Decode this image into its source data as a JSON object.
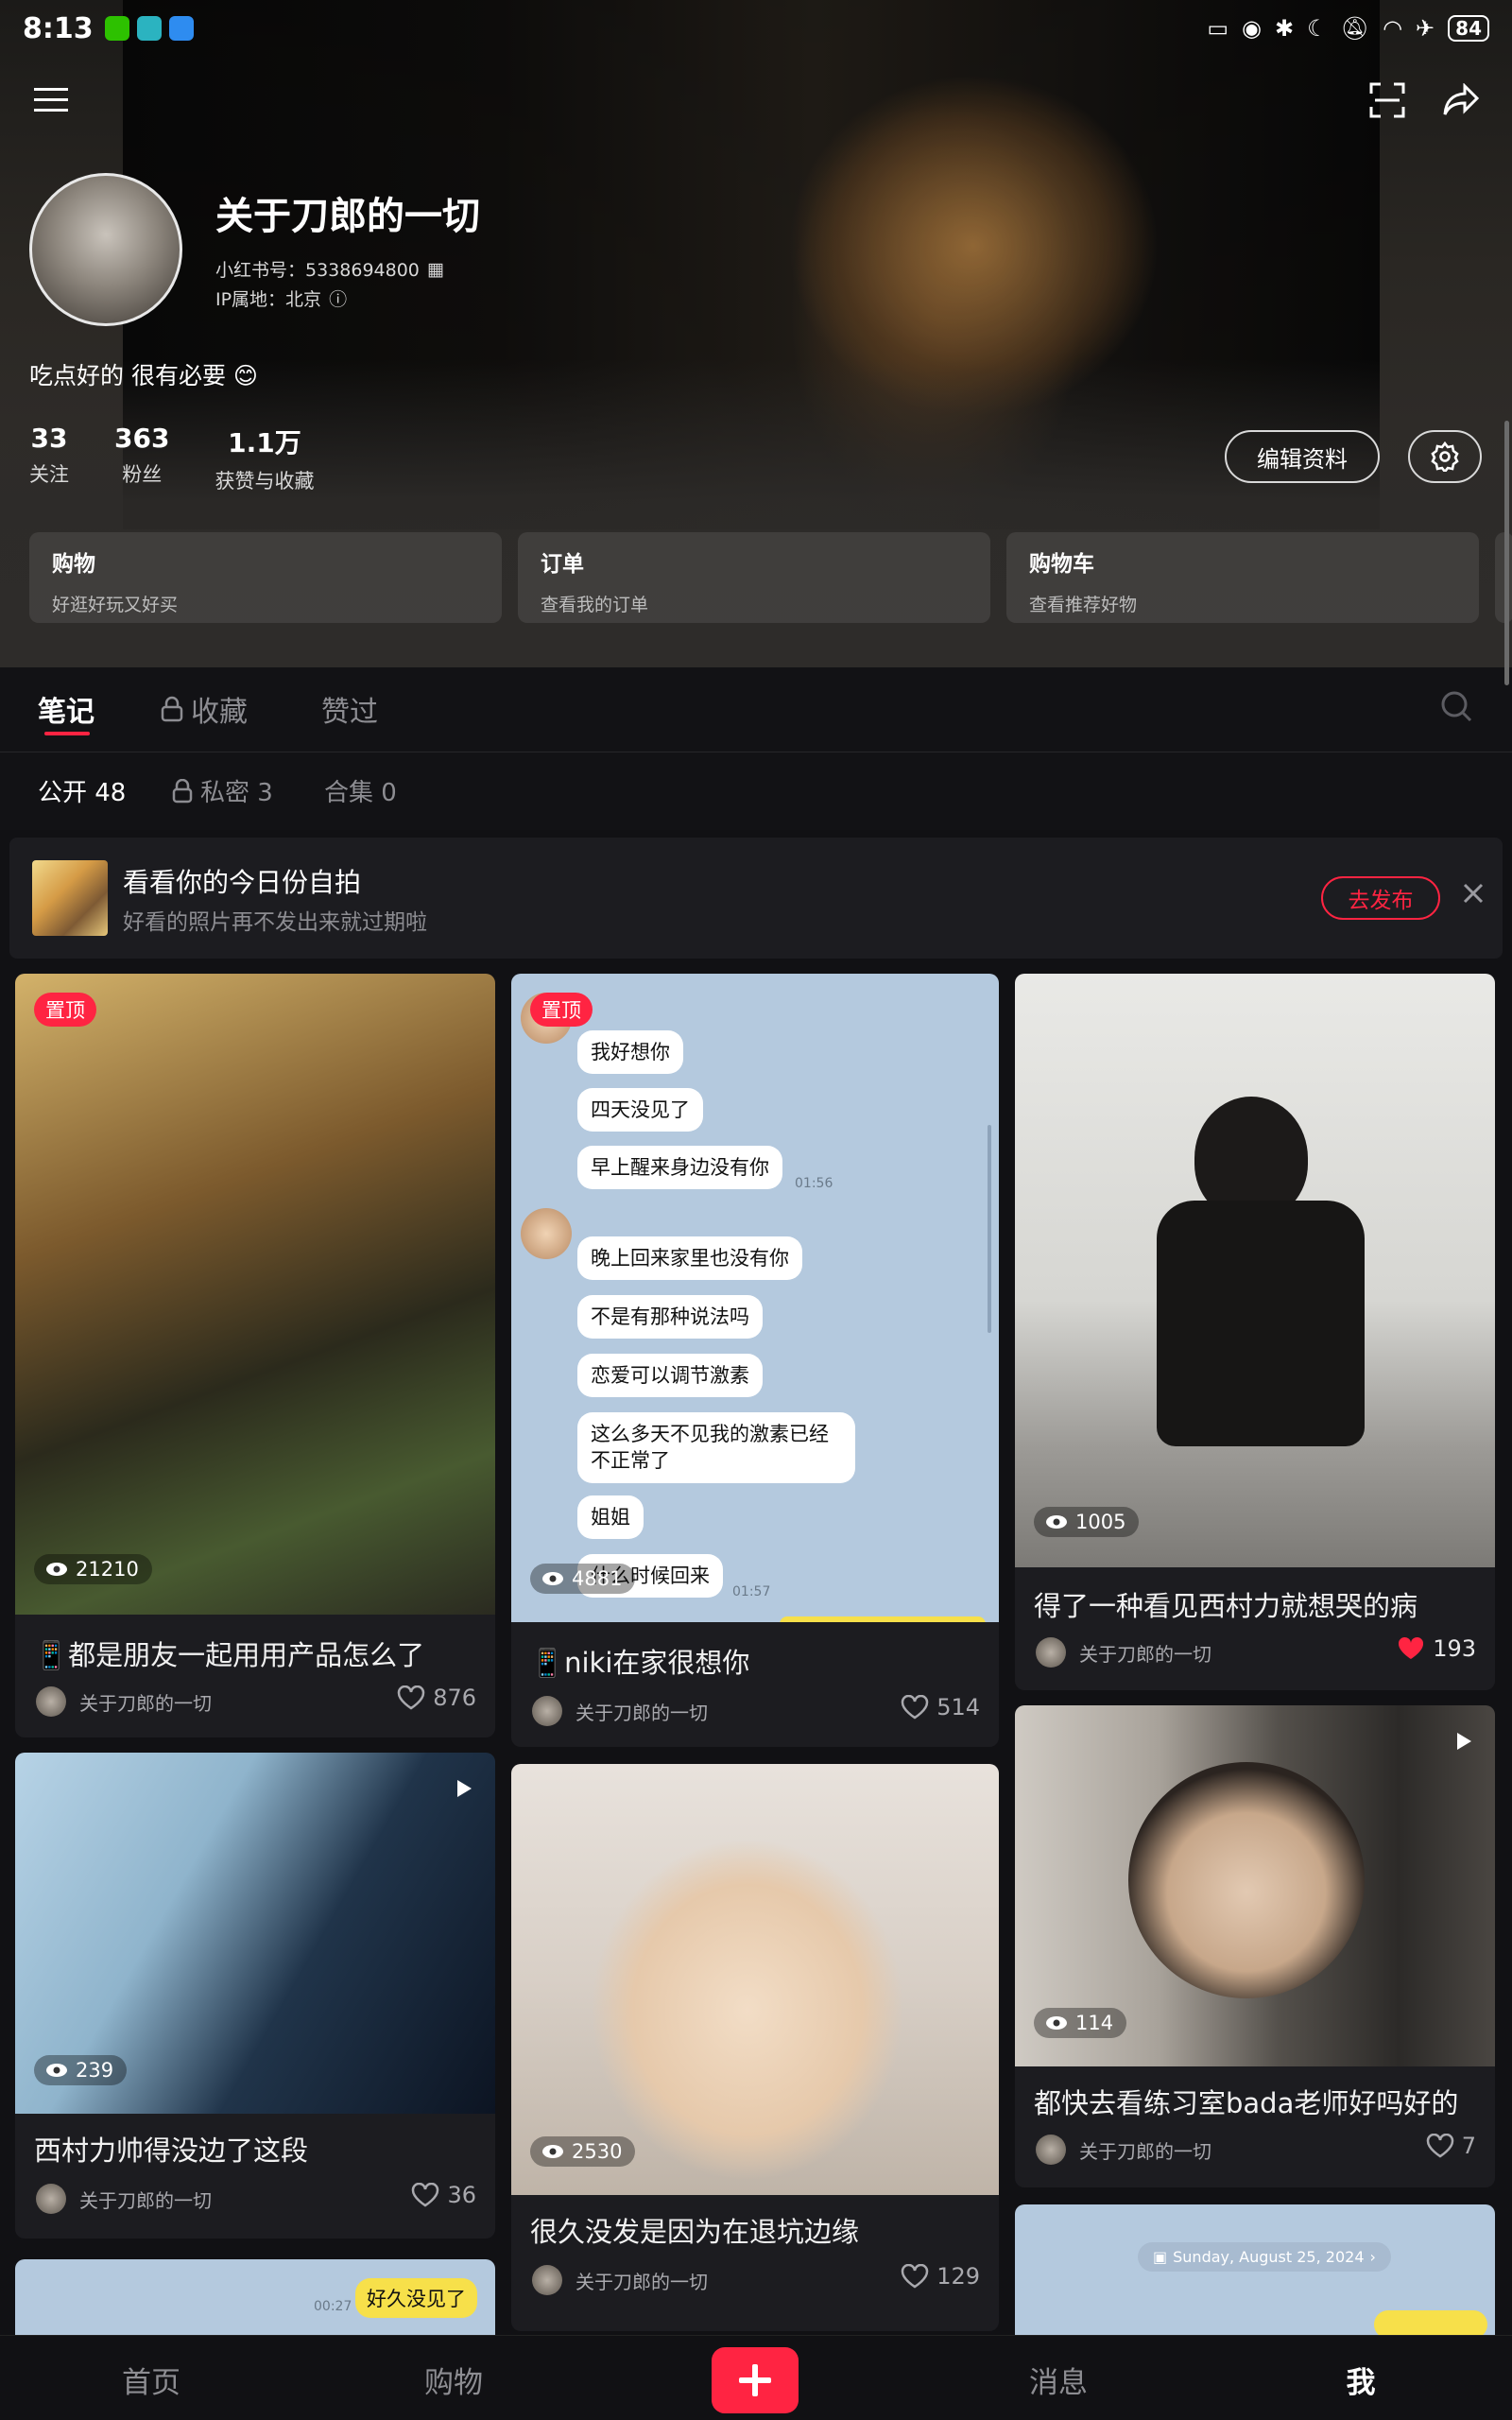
{
  "status_bar": {
    "time": "8:13",
    "battery": "84"
  },
  "profile": {
    "name": "关于刀郎的一切",
    "red_id": "小红书号：5338694800",
    "ip": "IP属地：北京",
    "bio": "吃点好的 很有必要 😊",
    "stats": [
      {
        "num": "33",
        "label": "关注"
      },
      {
        "num": "363",
        "label": "粉丝"
      },
      {
        "num": "1.1万",
        "label": "获赞与收藏"
      }
    ],
    "edit_label": "编辑资料"
  },
  "quick_cards": [
    {
      "title": "购物",
      "sub": "好逛好玩又好买"
    },
    {
      "title": "订单",
      "sub": "查看我的订单"
    },
    {
      "title": "购物车",
      "sub": "查看推荐好物"
    }
  ],
  "tabs": {
    "notes": "笔记",
    "collections": "收藏",
    "liked": "赞过"
  },
  "subtabs": {
    "public": "公开 48",
    "private": "私密 3",
    "albums": "合集 0"
  },
  "banner": {
    "title": "看看你的今日份自拍",
    "sub": "好看的照片再不发出来就过期啦",
    "button": "去发布"
  },
  "pin_label": "置顶",
  "author": "关于刀郎的一切",
  "cards": [
    {
      "title": "📱都是朋友一起用用产品怎么了",
      "views": "21210",
      "likes": "876"
    },
    {
      "title": "📱niki在家很想你",
      "views": "4881",
      "likes": "514"
    },
    {
      "title": "得了一种看见西村力就想哭的病",
      "views": "1005",
      "likes": "193"
    },
    {
      "title": "西村力帅得没边了这段",
      "views": "239",
      "likes": "36"
    },
    {
      "title": "很久没发是因为在退坑边缘",
      "views": "2530",
      "likes": "129"
    },
    {
      "title": "都快去看练习室bada老师好吗好的",
      "views": "114",
      "likes": "7"
    }
  ],
  "chat": {
    "bubbles": [
      "我好想你",
      "四天没见了",
      "早上醒来身边没有你",
      "晚上回来家里也没有你",
      "不是有那种说法吗",
      "恋爱可以调节激素",
      "这么多天不见我的激素已经不正常了",
      "姐姐",
      "什么时候回来"
    ],
    "time1": "01:56",
    "time2": "01:57"
  },
  "partial_cards": {
    "bubble": "好久没见了",
    "time": "00:27",
    "date": "Sunday, August 25, 2024"
  },
  "bottom_nav": {
    "home": "首页",
    "shop": "购物",
    "messages": "消息",
    "me": "我"
  },
  "colors": {
    "accent": "#ff2442",
    "background": "#111114",
    "card": "#1c1c20"
  }
}
